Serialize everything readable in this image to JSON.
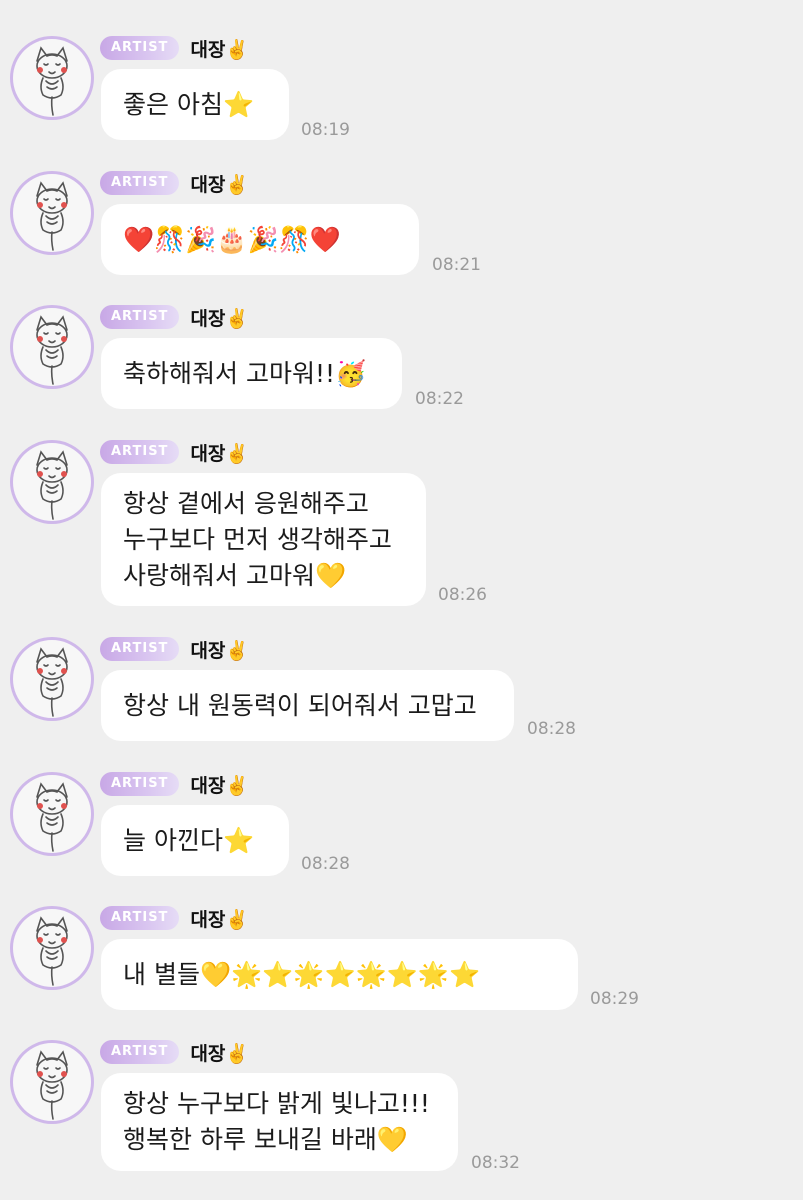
{
  "messages": [
    {
      "badge": "ARTIST",
      "sender": "대장✌️",
      "lines": [
        "좋은 아침⭐️"
      ],
      "time": "08:19"
    },
    {
      "badge": "ARTIST",
      "sender": "대장✌️",
      "lines": [
        "❤️🎊🎉🎂🎉🎊❤️"
      ],
      "time": "08:21"
    },
    {
      "badge": "ARTIST",
      "sender": "대장✌️",
      "lines": [
        "축하해줘서 고마워!!🥳"
      ],
      "time": "08:22"
    },
    {
      "badge": "ARTIST",
      "sender": "대장✌️",
      "lines": [
        "항상 곁에서 응원해주고",
        "누구보다 먼저 생각해주고",
        "사랑해줘서 고마워💛"
      ],
      "time": "08:26"
    },
    {
      "badge": "ARTIST",
      "sender": "대장✌️",
      "lines": [
        "항상 내 원동력이 되어줘서 고맙고"
      ],
      "time": "08:28"
    },
    {
      "badge": "ARTIST",
      "sender": "대장✌️",
      "lines": [
        "늘 아낀다⭐️"
      ],
      "time": "08:28"
    },
    {
      "badge": "ARTIST",
      "sender": "대장✌️",
      "lines": [
        "내 별들💛🌟⭐️🌟⭐️🌟⭐️🌟⭐️"
      ],
      "time": "08:29"
    },
    {
      "badge": "ARTIST",
      "sender": "대장✌️",
      "lines": [
        "항상 누구보다 밝게 빛나고!!!",
        "행복한 하루 보내길 바래💛"
      ],
      "time": "08:32"
    }
  ],
  "avatar_icon": "cat-doodle-avatar-icon",
  "colors": {
    "background": "#efefef",
    "bubble": "#ffffff",
    "badge": "#c8a8e6",
    "avatar_ring": "#cfb8ea",
    "time": "#9a9a9a"
  }
}
